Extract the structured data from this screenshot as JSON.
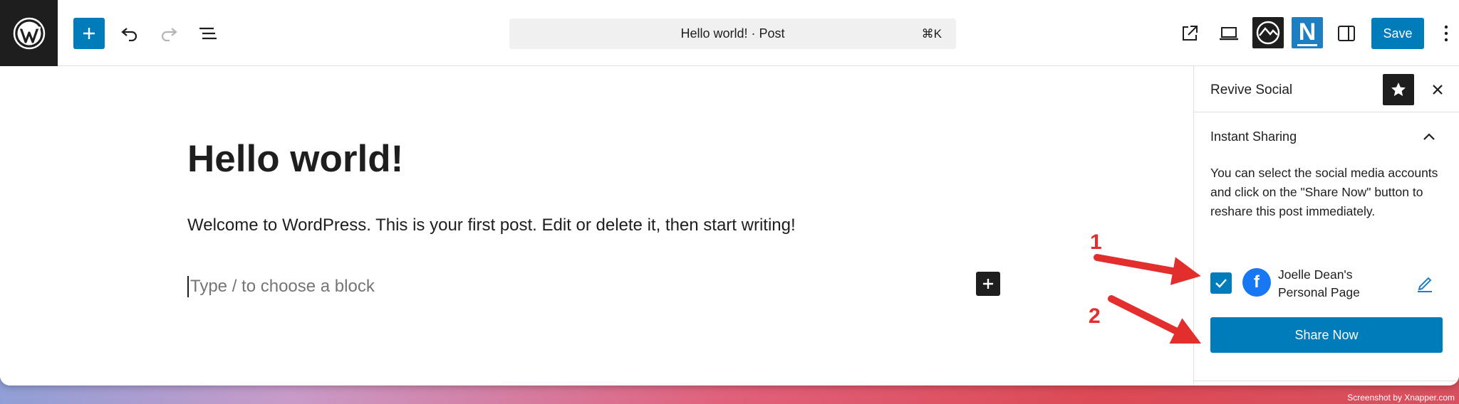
{
  "toolbar": {
    "command_bar_text": "Hello world! · Post",
    "command_shortcut": "⌘K",
    "save_label": "Save",
    "plugin_badge_letter": "N"
  },
  "editor": {
    "title": "Hello world!",
    "paragraph": "Welcome to WordPress. This is your first post. Edit or delete it, then start writing!",
    "block_placeholder": "Type / to choose a block"
  },
  "sidebar": {
    "title": "Revive Social",
    "panel_title": "Instant Sharing",
    "description": "You can select the social media accounts and click on the \"Share Now\" button to reshare this post immediately.",
    "account": {
      "name": "Joelle Dean's Personal Page",
      "network_icon_letter": "f",
      "checked": true
    },
    "share_button_label": "Share Now"
  },
  "annotations": {
    "label_1": "1",
    "label_2": "2",
    "color": "#e32e2e"
  },
  "credit": "Screenshot by Xnapper.com",
  "colors": {
    "accent": "#007cba",
    "dark": "#1e1e1e",
    "facebook": "#1877f2"
  }
}
